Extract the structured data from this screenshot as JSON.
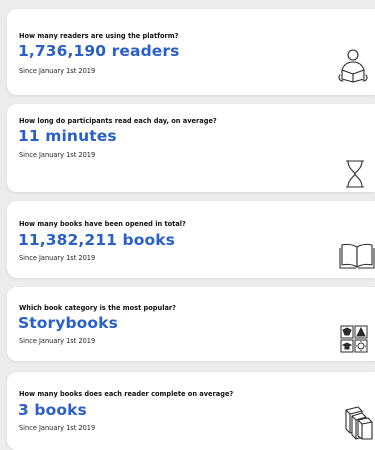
{
  "colors": {
    "accent": "#2b61c6",
    "card": "#ffffff",
    "background": "#ececec",
    "icon": "#2b2b2b"
  },
  "cards": [
    {
      "question": "How many readers are using the platform?",
      "value": "1,736,190 readers",
      "since": "Since January 1st 2019",
      "icon": "person-reading-icon"
    },
    {
      "question": "How long do participants read each day, on average?",
      "value": "11 minutes",
      "since": "Since January 1st 2019",
      "icon": "hourglass-icon"
    },
    {
      "question": "How many books have been opened in total?",
      "value": "11,382,211 books",
      "since": "Since January 1st 2019",
      "icon": "open-book-icon"
    },
    {
      "question": "Which book category is the most popular?",
      "value": "Storybooks",
      "since": "Since January 1st 2019",
      "icon": "book-categories-icon"
    },
    {
      "question": "How many books does each reader complete on average?",
      "value": "3 books",
      "since": "Since January 1st 2019",
      "icon": "stacked-books-icon"
    }
  ]
}
